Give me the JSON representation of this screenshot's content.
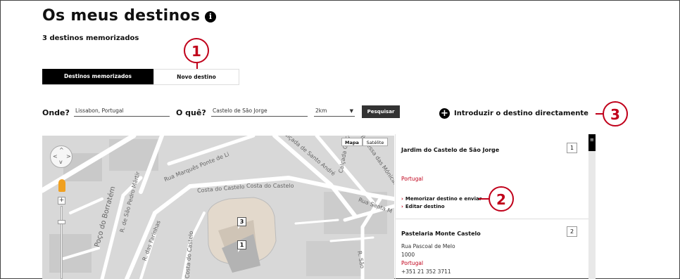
{
  "page": {
    "title": "Os meus destinos",
    "subtitle": "3 destinos memorizados"
  },
  "callouts": [
    "1",
    "2",
    "3"
  ],
  "tabs": [
    {
      "label": "Destinos memorizados",
      "active": true
    },
    {
      "label": "Novo destino",
      "active": false
    }
  ],
  "search": {
    "where_label": "Onde?",
    "where_value": "Lissabon, Portugal",
    "what_label": "O quê?",
    "what_value": "Castelo de São Jorge",
    "radius_value": "2km",
    "search_button": "Pesquisar"
  },
  "direct_entry": {
    "label": "Introduzir o destino directamente"
  },
  "map": {
    "type_map": "Mapa",
    "type_satellite": "Satélite",
    "street_labels": {
      "marques_ponte": "Rua Marquês Ponte de Li",
      "calcada_santo_andre": "Calçada de Santo André",
      "costa_castelo": "Costa do Castelo",
      "costa_castelo_2": "Costa do Castelo",
      "travessa_monicas": "Travessa das Mónicas",
      "rua_santa_m": "Rua Santa M",
      "r_sao_pedro_martir": "R. de São Pedro Mártir",
      "poco_borratem": "Poço do Borratém",
      "r_farinhas": "R. das Farinhas",
      "rua_costa_castelo": "Costa do Castelo",
      "r_sao": "R. São",
      "calcada_graca": "Calçada Graça",
      "r_vidrieira": "Rua Vidreira"
    },
    "markers": [
      "3",
      "1"
    ]
  },
  "destinations": [
    {
      "title": "Jardim do Castelo de São Jorge",
      "badge": "1",
      "country": "Portugal",
      "actions": [
        "Memorizar destino e enviar",
        "Editar destino"
      ]
    },
    {
      "title": "Pastelaria Monte Castelo",
      "badge": "2",
      "street": "Rua Pascoal de Melo",
      "postal": "1000",
      "country": "Portugal",
      "phone": "+351 21 352 3711"
    }
  ],
  "colors": {
    "accent": "#c0001a",
    "dark": "#000000",
    "map_bg": "#dcdcdc"
  }
}
